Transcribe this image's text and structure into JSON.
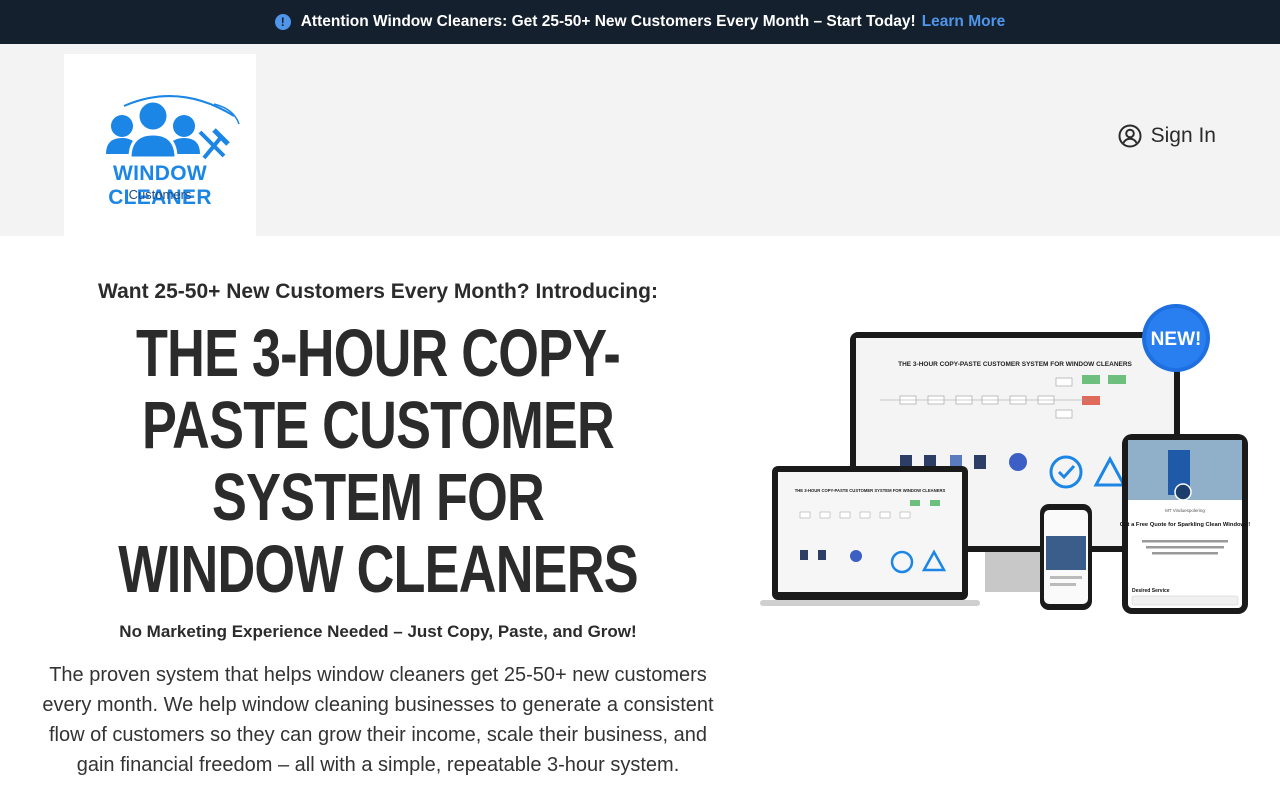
{
  "announcement": {
    "message": "Attention Window Cleaners: Get 25-50+ New Customers Every Month – Start Today!",
    "link_label": "Learn More",
    "icon": "info-circle-icon"
  },
  "header": {
    "logo": {
      "wordmark": "WINDOW CLEANER",
      "sub": "Customers"
    },
    "signin_label": "Sign In",
    "signin_icon": "user-circle-icon"
  },
  "hero": {
    "pre_headline": "Want 25-50+ New Customers Every Month? Introducing:",
    "headline": "The 3-Hour Copy-Paste Customer System for Window Cleaners",
    "subheadline": "No Marketing Experience Needed – Just Copy, Paste, and Grow!",
    "body": "The proven system that helps window cleaners get 25-50+ new customers every month. We help window cleaning businesses to generate a consistent flow of customers so they can grow their income, scale their business, and gain financial freedom – all with a simple, repeatable 3-hour system."
  },
  "mockup": {
    "badge": "NEW!",
    "monitor_title": "THE 3-HOUR COPY-PASTE CUSTOMER SYSTEM FOR WINDOW CLEANERS",
    "laptop_title": "THE 3-HOUR COPY-PASTE CUSTOMER SYSTEM FOR WINDOW CLEANERS",
    "tablet_brand": "MT Vinduespolering",
    "tablet_heading": "Get a Free Quote for Sparkling Clean Windows!",
    "tablet_text": "Fill out the form, and we'll contact you within 24 hours. Enjoy crystal-clear windows without the hassle!",
    "tablet_field": "Desired Service"
  },
  "colors": {
    "topbar_bg": "#14202e",
    "accent_blue": "#4f95ea",
    "logo_blue": "#1b86e6",
    "header_bg": "#f3f3f3",
    "text_dark": "#2b2b2b"
  }
}
